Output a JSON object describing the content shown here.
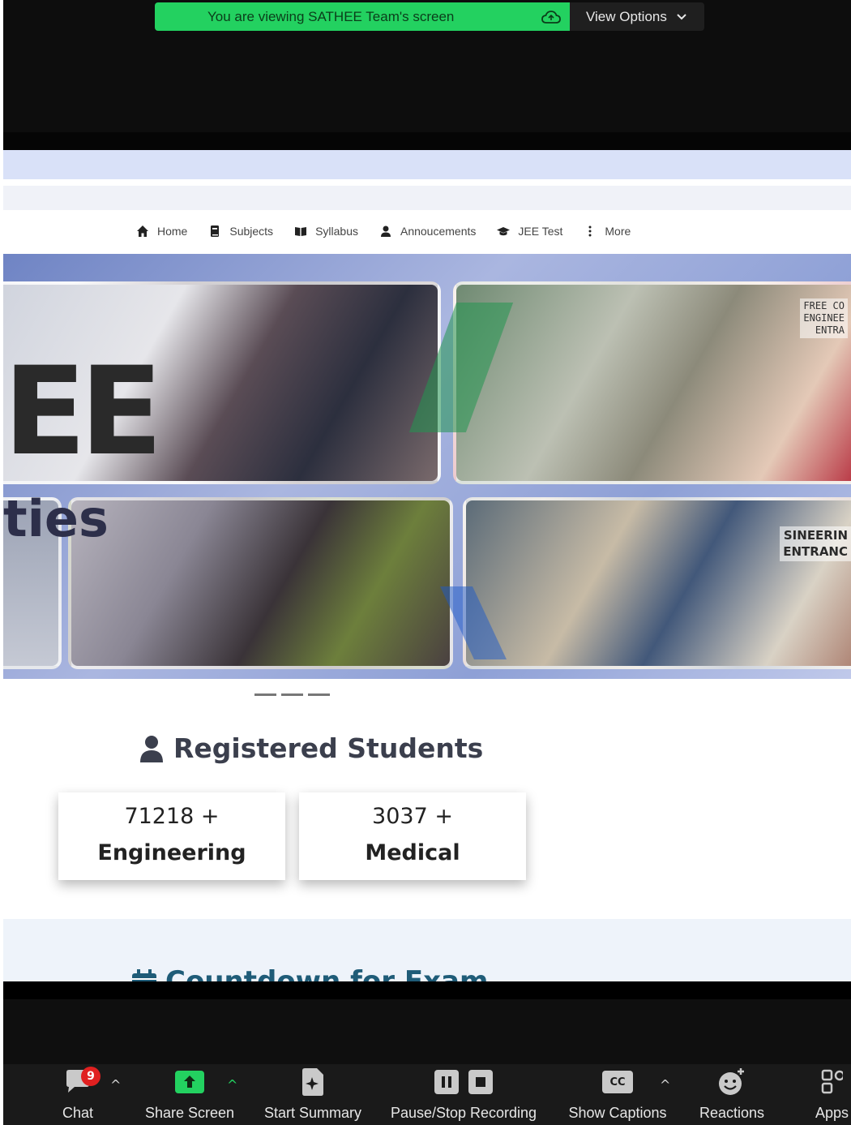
{
  "banner": {
    "message": "You are viewing SATHEE Team's screen",
    "view_options": "View Options",
    "banner_color": "#23d160"
  },
  "nav": {
    "items": [
      {
        "label": "Home",
        "icon": "home-icon"
      },
      {
        "label": "Subjects",
        "icon": "book-icon"
      },
      {
        "label": "Syllabus",
        "icon": "open-book-icon"
      },
      {
        "label": "Annoucements",
        "icon": "user-icon"
      },
      {
        "label": "JEE Test",
        "icon": "graduation-cap-icon"
      },
      {
        "label": "More",
        "icon": "more-vertical-icon"
      }
    ]
  },
  "hero": {
    "big_letters": "EE",
    "word_fragment": "ties",
    "photo_text_top": "FREE CO\nENGINEE\nENTRA",
    "photo_text_bottom": "SINEERIN\nENTRANC"
  },
  "registered": {
    "title": "Registered Students",
    "cards": [
      {
        "count": "71218 +",
        "label": "Engineering"
      },
      {
        "count": "3037 +",
        "label": "Medical"
      }
    ]
  },
  "countdown": {
    "title": "Countdown for Exam"
  },
  "toolbar": {
    "chat": {
      "label": "Chat",
      "badge": "9"
    },
    "share_screen": {
      "label": "Share Screen"
    },
    "start_summary": {
      "label": "Start Summary"
    },
    "recording": {
      "label": "Pause/Stop Recording"
    },
    "captions": {
      "label": "Show Captions",
      "cc": "CC"
    },
    "reactions": {
      "label": "Reactions"
    },
    "apps": {
      "label": "Apps"
    },
    "accent_color": "#23d160"
  }
}
